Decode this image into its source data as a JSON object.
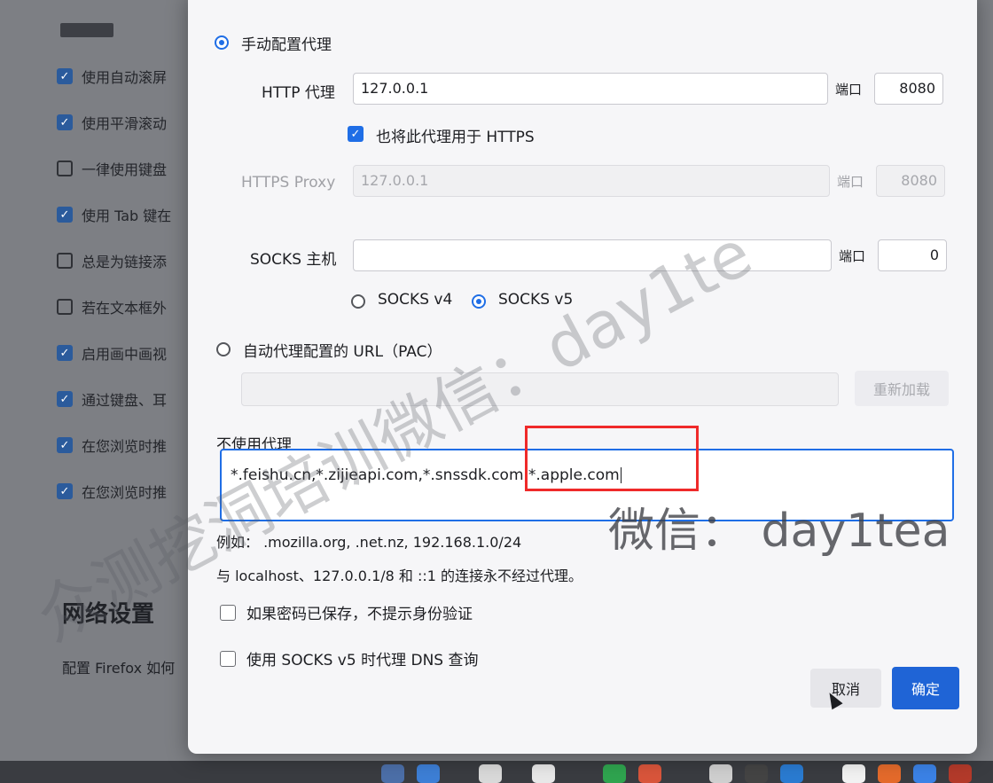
{
  "background": {
    "items": [
      {
        "checked": true,
        "label": "使用自动滚屏"
      },
      {
        "checked": true,
        "label": "使用平滑滚动"
      },
      {
        "checked": false,
        "label": "一律使用键盘"
      },
      {
        "checked": true,
        "label": "使用 Tab 键在"
      },
      {
        "checked": false,
        "label": "总是为链接添"
      },
      {
        "checked": false,
        "label": "若在文本框外"
      },
      {
        "checked": true,
        "label": "启用画中画视"
      },
      {
        "checked": true,
        "label": "通过键盘、耳"
      },
      {
        "checked": true,
        "label": "在您浏览时推"
      },
      {
        "checked": true,
        "label": "在您浏览时推"
      }
    ],
    "section_title": "网络设置",
    "section_desc": "配置 Firefox 如何"
  },
  "dialog": {
    "manual_proxy": {
      "label": "手动配置代理",
      "selected": true
    },
    "http": {
      "label": "HTTP 代理",
      "value": "127.0.0.1",
      "port_label": "端口",
      "port": "8080"
    },
    "also_https": {
      "label": "也将此代理用于 HTTPS",
      "checked": true
    },
    "https": {
      "label": "HTTPS Proxy",
      "value": "127.0.0.1",
      "port_label": "端口",
      "port": "8080"
    },
    "socks": {
      "label": "SOCKS 主机",
      "value": "",
      "port_label": "端口",
      "port": "0"
    },
    "socks_v4": {
      "label": "SOCKS v4",
      "selected": false
    },
    "socks_v5": {
      "label": "SOCKS v5",
      "selected": true
    },
    "pac": {
      "label": "自动代理配置的 URL（PAC）",
      "selected": false,
      "value": "",
      "reload_label": "重新加载"
    },
    "no_proxy": {
      "label": "不使用代理",
      "value": "*.feishu.cn,*.zijieapi.com,*.snssdk.com,*.apple.com"
    },
    "example_text": "例如： .mozilla.org, .net.nz, 192.168.1.0/24",
    "localhost_note": "与 localhost、127.0.0.1/8 和 ::1 的连接永不经过代理。",
    "no_auth_prompt": {
      "label": "如果密码已保存，不提示身份验证",
      "checked": false
    },
    "socks_dns": {
      "label": "使用 SOCKS v5 时代理 DNS 查询",
      "checked": false
    },
    "cancel_label": "取消",
    "ok_label": "确定"
  },
  "watermark": {
    "text_main": "众测挖洞培训微信：day1te",
    "text_secondary": "微信：  day1tea"
  },
  "colors": {
    "accent": "#1f6ee6",
    "highlight": "#ef2a2a",
    "primary_button": "#1f64d6"
  }
}
